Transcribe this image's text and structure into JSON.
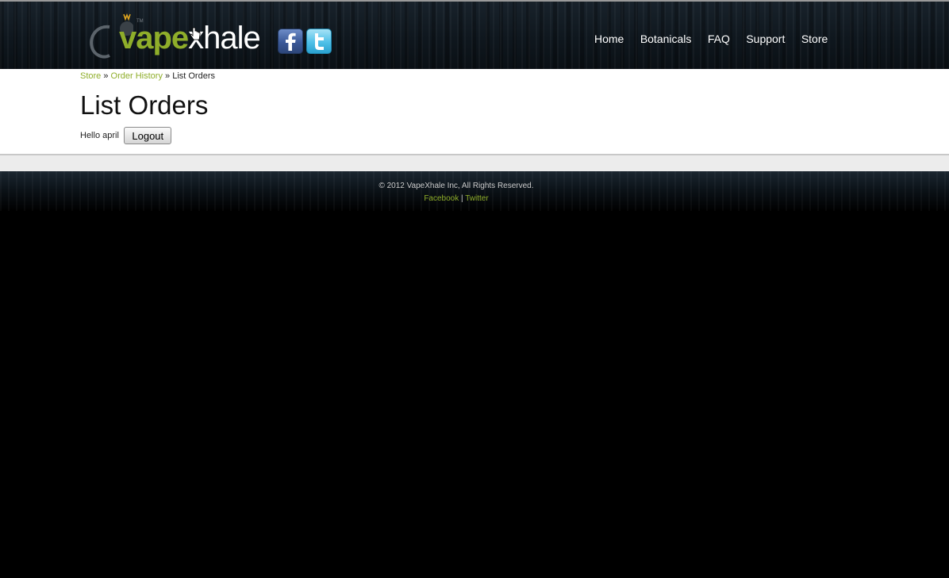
{
  "header": {
    "logo": {
      "part1": "vape",
      "part2": "xhale",
      "tm": "TM"
    },
    "social": {
      "facebook_icon": "facebook-icon",
      "twitter_icon": "twitter-icon"
    },
    "nav": [
      {
        "label": "Home"
      },
      {
        "label": "Botanicals"
      },
      {
        "label": "FAQ"
      },
      {
        "label": "Support"
      },
      {
        "label": "Store"
      }
    ]
  },
  "breadcrumb": {
    "items": [
      {
        "label": "Store"
      },
      {
        "label": "Order History"
      },
      {
        "label": "List Orders"
      }
    ],
    "separator": "»"
  },
  "main": {
    "title": "List Orders",
    "greeting": "Hello april",
    "logout_label": "Logout"
  },
  "footer": {
    "copyright": "© 2012 VapeXhale Inc, All Rights Reserved.",
    "links": [
      {
        "label": "Facebook"
      },
      {
        "label": "Twitter"
      }
    ],
    "link_separator": "|"
  },
  "colors": {
    "accent_green": "#8fae2a",
    "header_bg": "#121b22",
    "footer_bg": "#000000"
  }
}
